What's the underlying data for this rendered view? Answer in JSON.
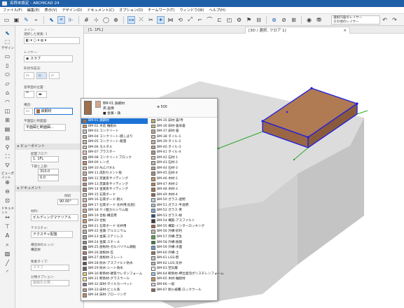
{
  "window": {
    "title": "名称未設定 - ARCHICAD 24"
  },
  "menu": [
    "ファイル(F)",
    "編集(E)",
    "表示(V)",
    "デザイン(D)",
    "ドキュメント(C)",
    "オプション(O)",
    "チームワーク(T)",
    "ウィンドウ(W)",
    "ヘルプ(H)"
  ],
  "toolbar": {
    "layer_line1": "選択内容のレイヤー",
    "layer_line2": "その他のレイヤー"
  },
  "toolbox": {
    "arrow_label": "矢印",
    "design_label": "デザイン",
    "viewpoint_label": "ビューポイント",
    "document_label": "ドキュメント"
  },
  "info": {
    "main_label": "メイン:",
    "selected_label": "選択した要素: 1",
    "layer_label": "レイヤー:",
    "layer_value": "スラブ",
    "geometry_label": "形状作成法:",
    "reference_label": "基準面の位置:",
    "structure_label": "構造:",
    "structure_value": "鉄鋼材",
    "floorplan_label": "平面図と断面図:",
    "floorplan_value": "平面図と断面図...",
    "viewpoint_section": "ビューポイント",
    "home_floor_label": "配置フロア:",
    "home_floor_value": "1. 1FL",
    "offset_label": "下部と上部:",
    "offset_value1": "310.0",
    "offset_value2": "0.0",
    "doc_section": "ドキュメント",
    "angle_value": "90.00°",
    "angle_label": "傾斜",
    "material_label": "材料:",
    "material_value": "ビルディングマテリアル",
    "texture_label": "テクスチャ:",
    "texture_value": "テクスチャ配置",
    "edge_label": "構造材のエッジ:",
    "edge_value": "構造材",
    "element_type_label": "要素タイプ:",
    "element_type_value": "スラブ",
    "classification_label": "分類オプション:",
    "classification_value": "面積を計算..."
  },
  "tabs": {
    "plan": "[1. 1FL]",
    "view3d": "[3D / 選択, フロア 1]",
    "close": "×"
  },
  "popup": {
    "selected_name": "BM-01 鉄鋼材",
    "line2": "高 画像",
    "line3": "■ 金属・鉄",
    "code": "⊕ 500"
  },
  "materials_left": [
    {
      "label": "BM-01 鉄鋼材",
      "color": "#a06f4c",
      "selected": true
    },
    {
      "label": "BM-02 木造 軸組み",
      "color": "#c99a6b"
    },
    {
      "label": "BM-03 コンクリート",
      "color": "#c8c2b8"
    },
    {
      "label": "BM-04 コンクリート-膜しばり",
      "color": "#c9b6aa"
    },
    {
      "label": "BM-05 コンクリート-軽量",
      "color": "#cabba8"
    },
    {
      "label": "BM-06 モルタル",
      "color": "#d8c8bb"
    },
    {
      "label": "BM-07 プラスター",
      "color": "#e7c4b7"
    },
    {
      "label": "BM-08 コンクリートブロック",
      "color": "#b9a79d"
    },
    {
      "label": "BM-09 レンガ",
      "color": "#c78a74"
    },
    {
      "label": "BM-10 ALCパネル",
      "color": "#dcc7b6"
    },
    {
      "label": "BM-11 成形セメント板",
      "color": "#cab1a6"
    },
    {
      "label": "BM-12 窯業系サイディング",
      "color": "#c89a87"
    },
    {
      "label": "BM-13 窯業系サイディング",
      "color": "#bd907e"
    },
    {
      "label": "BM-14 金属系サイディング",
      "color": "#a38a84"
    },
    {
      "label": "BM-15 石膏ボード",
      "color": "#e2cdbd"
    },
    {
      "label": "BM-16 石膏ボード-耐火",
      "color": "#d9b9aa"
    },
    {
      "label": "BM-17 石膏ボード-天井用(化粧)",
      "color": "#d3b2a5"
    },
    {
      "label": "BM-18 ケイ酸カルシウム板",
      "color": "#c9ab9f"
    },
    {
      "label": "BM-19 合板-構造用",
      "color": "#d7a47a"
    },
    {
      "label": "BM-20 合板",
      "color": "#cf9a6f"
    },
    {
      "label": "BM-21 石膏ボード-天井用",
      "color": "#d8bcae"
    },
    {
      "label": "BM-22 金属-アルミニウム",
      "color": "#b7b2b0"
    },
    {
      "label": "BM-23 金属-ステンレス",
      "color": "#a8a2a0"
    },
    {
      "label": "BM-24 金属-スチール",
      "color": "#8f8581"
    },
    {
      "label": "BM-25 屋根材-ガルバリウム鋼板",
      "color": "#7d7470"
    },
    {
      "label": "BM-26 屋根材-瓦",
      "color": "#b47d68"
    },
    {
      "label": "BM-27 屋根材-スレート",
      "color": "#7a6c69"
    },
    {
      "label": "BM-28 防水-アスファルト防水",
      "color": "#5c5250"
    },
    {
      "label": "BM-29 防水-シート防水",
      "color": "#6f6360"
    },
    {
      "label": "BM-30 断熱材-硬質ウレタンフォーム",
      "color": "#e8d27a"
    },
    {
      "label": "BM-31 断熱材-グラスウール",
      "color": "#efe09a"
    },
    {
      "label": "BM-32 床材-タイルカーペット",
      "color": "#8c7b86"
    },
    {
      "label": "BM-33 床材-ビニル系",
      "color": "#b69d93"
    },
    {
      "label": "BM-34 床材-フローリング",
      "color": "#c08a5f"
    }
  ],
  "materials_right": [
    {
      "label": "BM-35 床材-畳/寺",
      "color": "#b8b07a"
    },
    {
      "label": "BM-36 床材-畳床畳",
      "color": "#c7b98c"
    },
    {
      "label": "BM-37 床材-畳",
      "color": "#b8a98a"
    },
    {
      "label": "BM-38 タイル-1",
      "color": "#d6c4b6"
    },
    {
      "label": "BM-39 タイル-2",
      "color": "#c6b1a4"
    },
    {
      "label": "BM-40 タイル-3",
      "color": "#b8a396"
    },
    {
      "label": "BM-41 タイル-4",
      "color": "#a9968c"
    },
    {
      "label": "BM-42 石材-1",
      "color": "#cfc6bd"
    },
    {
      "label": "BM-43 石材-2",
      "color": "#bfb5ab"
    },
    {
      "label": "BM-44 石材-3",
      "color": "#aea398"
    },
    {
      "label": "BM-45 石材-4",
      "color": "#9e9286"
    },
    {
      "label": "BM-46 木材-1",
      "color": "#c89468"
    },
    {
      "label": "BM-47 木材-2",
      "color": "#b7835c"
    },
    {
      "label": "BM-48 木材-3",
      "color": "#a77453"
    },
    {
      "label": "BM-49 木材-4",
      "color": "#97674b"
    },
    {
      "label": "BM-50 ガラス-透明",
      "color": "#b9d1e0"
    },
    {
      "label": "BM-51 ガラス-半透明",
      "color": "#a9c4d6"
    },
    {
      "label": "BM-52 ガラス-青",
      "color": "#7ea6cf"
    },
    {
      "label": "BM-53 ガラス-緑",
      "color": "#2c4d8c"
    },
    {
      "label": "BM-54 構築-アスファルト",
      "color": "#3d3d3d"
    },
    {
      "label": "BM-55 構築-インターロッキング",
      "color": "#b0614c"
    },
    {
      "label": "BM-56 外構-砂利",
      "color": "#c2b7ab"
    },
    {
      "label": "BM-57 外構-芝生",
      "color": "#58a24a"
    },
    {
      "label": "BM-58 外構-植栽",
      "color": "#3c7d3a"
    },
    {
      "label": "BM-59 外構-水面",
      "color": "#6ea0c8"
    },
    {
      "label": "BM-60 外構-土",
      "color": "#9a7658"
    },
    {
      "label": "BM-61 LGS-壁",
      "color": "#c7c1bf"
    },
    {
      "label": "BM-62 LGS-天井",
      "color": "#bdb6b3"
    },
    {
      "label": "BM-63 空気層",
      "color": "#f0eeee"
    },
    {
      "label": "BM-64 断熱材-押出発泡ポリスチレンフォーム",
      "color": "#9fc6e6"
    },
    {
      "label": "BM-65 木材-軸組材",
      "color": "#c59061"
    },
    {
      "label": "BM-66 一般",
      "color": "#d9d9d9"
    },
    {
      "label": "BM-67 耐火被覆-ロックウール",
      "color": "#8b6c5c"
    }
  ],
  "colors": {
    "accent": "#1c73d6",
    "titlebar": "#1f5fa8",
    "slab_top": "#b07a53",
    "selection": "#1e1ee0",
    "ground": "#d6d6d6"
  }
}
